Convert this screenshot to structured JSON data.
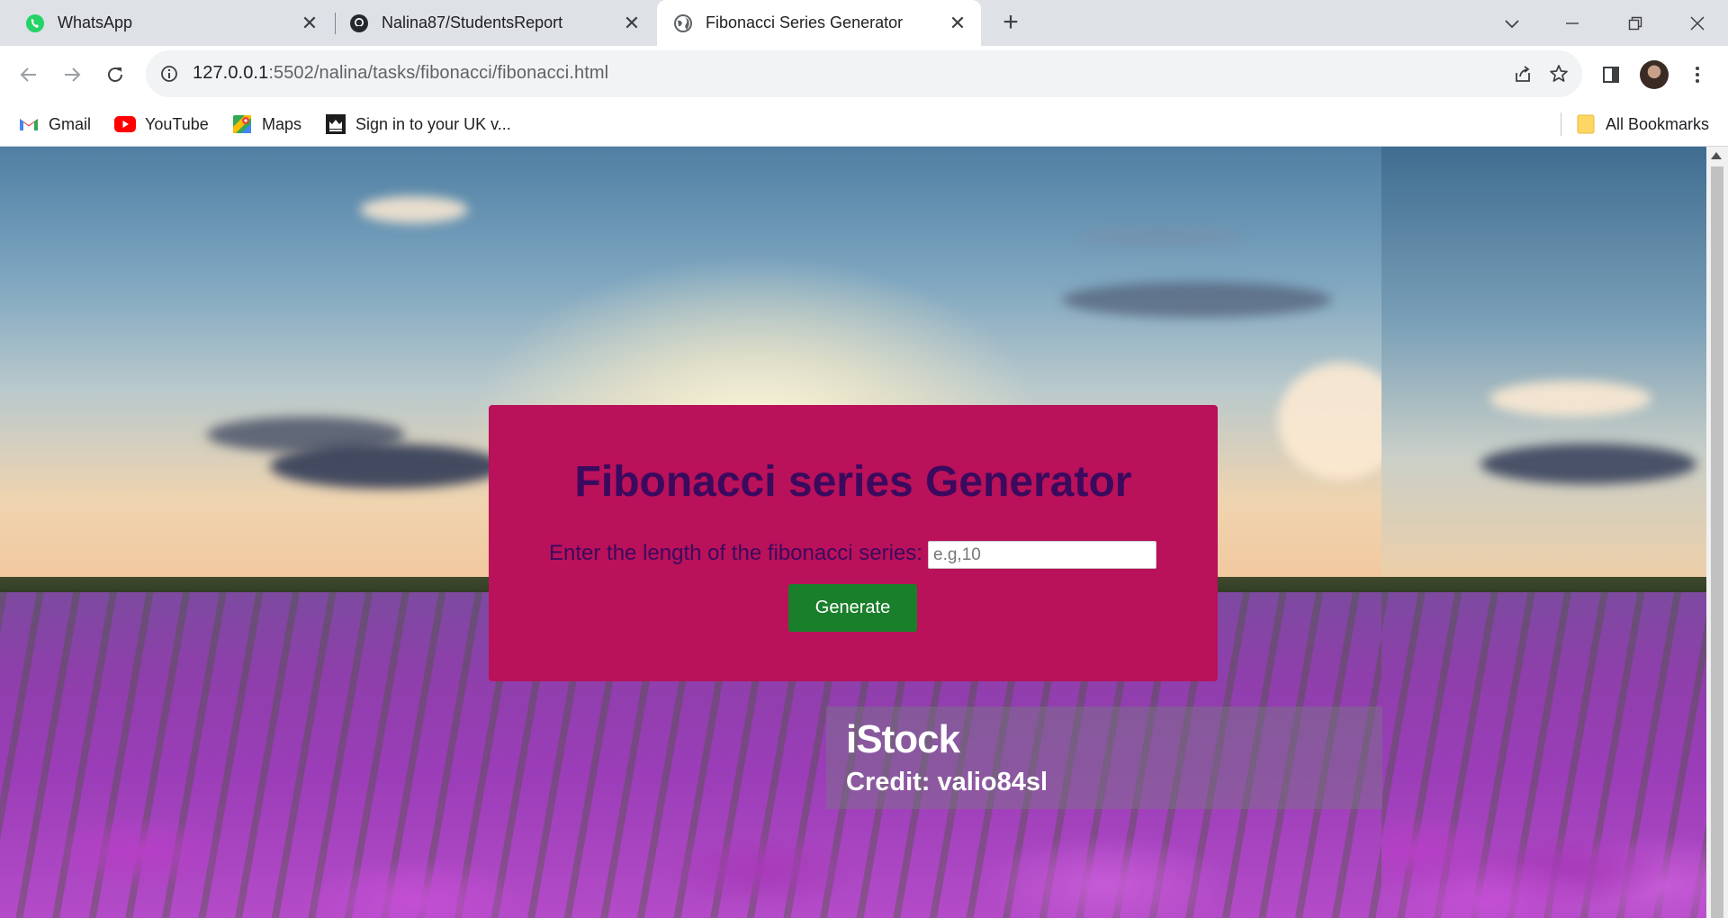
{
  "tabs": [
    {
      "title": "WhatsApp",
      "icon": "whatsapp-icon"
    },
    {
      "title": "Nalina87/StudentsReport",
      "icon": "github-icon"
    },
    {
      "title": "Fibonacci Series Generator",
      "icon": "globe-icon"
    }
  ],
  "tab_close": "✕",
  "new_tab": "+",
  "address": {
    "host": "127.0.0.1",
    "rest": ":5502/nalina/tasks/fibonacci/fibonacci.html"
  },
  "bookmarks": [
    {
      "label": "Gmail",
      "icon": "gmail-icon"
    },
    {
      "label": "YouTube",
      "icon": "youtube-icon"
    },
    {
      "label": "Maps",
      "icon": "maps-icon"
    },
    {
      "label": "Sign in to your UK v...",
      "icon": "crown-icon"
    }
  ],
  "all_bookmarks": "All Bookmarks",
  "page": {
    "heading": "Fibonacci series Generator",
    "prompt": "Enter the length of the fibonacci series:",
    "input_placeholder": "e.g,10",
    "input_value": "",
    "button_label": "Generate"
  },
  "watermark": {
    "logo": "iStock",
    "credit": "Credit: valio84sl"
  },
  "colors": {
    "card": "#b9115a",
    "heading": "#3a0a5e",
    "button": "#1a7f2b"
  }
}
